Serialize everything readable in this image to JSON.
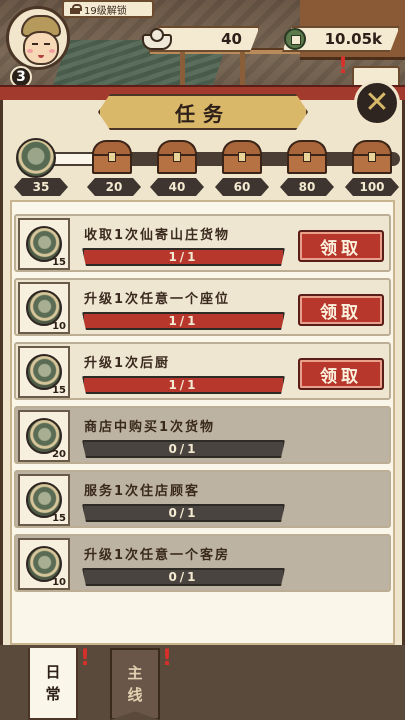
{
  "player": {
    "level": "3",
    "unlock_text": "19级解锁"
  },
  "currency": {
    "gold": "40",
    "coins": "10.05k"
  },
  "panel": {
    "title": "任务",
    "close_icon": "close-icon"
  },
  "progress": {
    "current_points": "35",
    "fill_fraction": 0.18,
    "milestones": [
      "20",
      "40",
      "60",
      "80",
      "100"
    ]
  },
  "tasks": [
    {
      "name": "收取1次仙寄山庄货物",
      "progress": "1/1",
      "points": "15",
      "fraction": 1,
      "claimable": true,
      "button": "领取"
    },
    {
      "name": "升级1次任意一个座位",
      "progress": "1/1",
      "points": "10",
      "fraction": 1,
      "claimable": true,
      "button": "领取"
    },
    {
      "name": "升级1次后厨",
      "progress": "1/1",
      "points": "15",
      "fraction": 1,
      "claimable": true,
      "button": "领取"
    },
    {
      "name": "商店中购买1次货物",
      "progress": "0/1",
      "points": "20",
      "fraction": 0,
      "claimable": false
    },
    {
      "name": "服务1次住店顾客",
      "progress": "0/1",
      "points": "15",
      "fraction": 0,
      "claimable": false
    },
    {
      "name": "升级1次任意一个客房",
      "progress": "0/1",
      "points": "10",
      "fraction": 0,
      "claimable": false
    }
  ],
  "tabs": {
    "daily": [
      "日",
      "常"
    ],
    "main": [
      "主",
      "线"
    ],
    "alert": "!"
  },
  "colors": {
    "accent_red": "#b8372c",
    "panel": "#efe4cc",
    "dark": "#2e2520"
  }
}
